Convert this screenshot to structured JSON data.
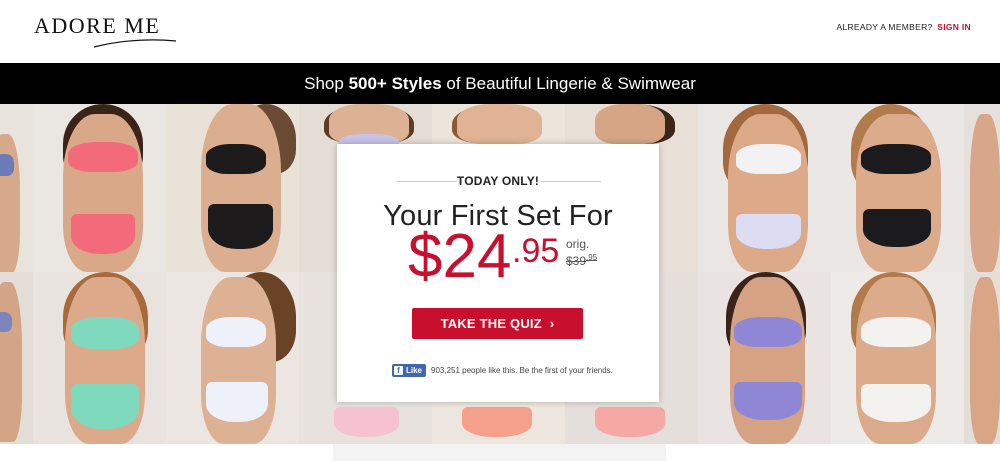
{
  "header": {
    "logo_text": "ADORE ME",
    "member_prompt": "ALREADY A MEMBER?",
    "sign_in": "SIGN IN"
  },
  "banner": {
    "prefix": "Shop",
    "highlight": "500+ Styles",
    "suffix": "of Beautiful Lingerie & Swimwear"
  },
  "promo": {
    "eyebrow": "TODAY ONLY!",
    "headline": "Your First Set For",
    "price_dollars": "$24",
    "price_cents": ".95",
    "orig_label": "orig.",
    "orig_price": "$39",
    "orig_cents": ".95",
    "cta": "TAKE THE QUIZ",
    "cta_icon": "›",
    "fb_like": "Like",
    "fb_text": "903,251 people like this. Be the first of your friends."
  },
  "colors": {
    "brand_red": "#c8102e",
    "banner_bg": "#000000",
    "facebook_blue": "#4267b2"
  }
}
